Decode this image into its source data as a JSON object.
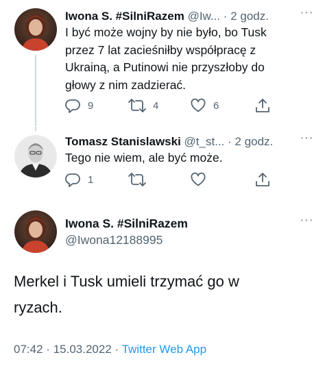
{
  "tweets": [
    {
      "author_name": "Iwona S. #SilniRazem",
      "handle": "@Iw...",
      "separator": "·",
      "time": "2 godz.",
      "text_lines": [
        "I być może wojny by nie było, bo Tusk",
        "przez 7 lat zacieśniłby współpracę z",
        "Ukrainą, a Putinowi nie przyszłoby do",
        "głowy z nim zadzierać."
      ],
      "replies": "9",
      "retweets": "4",
      "likes": "6"
    },
    {
      "author_name": "Tomasz Stanislawski",
      "handle": "@t_st...",
      "separator": "·",
      "time": "2 godz.",
      "text_lines": [
        "Tego nie wiem, ale być może."
      ],
      "replies": "1",
      "retweets": "",
      "likes": ""
    }
  ],
  "main_tweet": {
    "author_name": "Iwona S. #SilniRazem",
    "handle": "@Iwona12188995",
    "text_lines": [
      "Merkel i Tusk umieli trzymać go w",
      "ryzach."
    ],
    "time": "07:42",
    "date": "15.03.2022",
    "separator": "·",
    "source": "Twitter Web App"
  },
  "icons": {
    "more": "more-dots-icon",
    "reply": "reply-icon",
    "retweet": "retweet-icon",
    "like": "heart-icon",
    "share": "share-icon"
  },
  "colors": {
    "text": "#0f1419",
    "secondary": "#536471",
    "link": "#1d9bf0",
    "thread_line": "#cfd9de"
  }
}
